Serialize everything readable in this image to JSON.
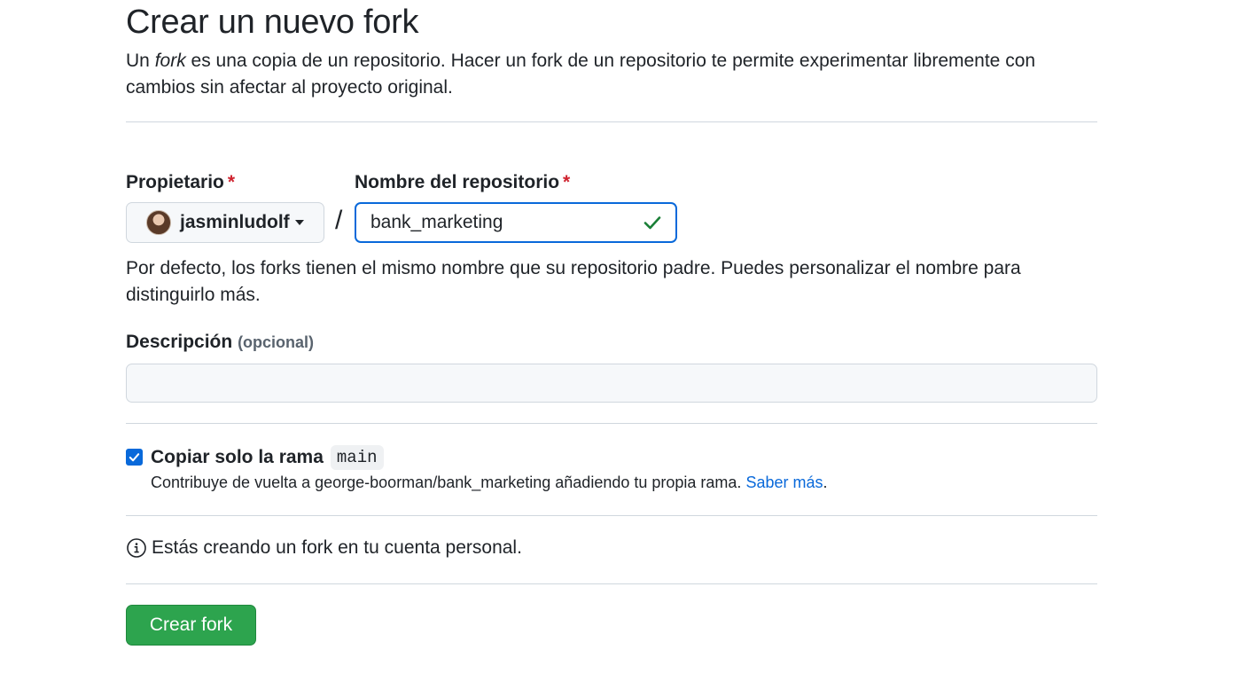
{
  "header": {
    "title": "Crear un nuevo fork",
    "subtitle_pre": "Un ",
    "subtitle_em": "fork",
    "subtitle_post": " es una copia de un repositorio. Hacer un fork de un repositorio te permite experimentar libremente con cambios sin afectar al proyecto original."
  },
  "owner": {
    "label": "Propietario",
    "required_mark": "*",
    "value": "jasminludolf"
  },
  "separator": "/",
  "repository": {
    "label": "Nombre del repositorio",
    "required_mark": "*",
    "value": "bank_marketing",
    "help": "Por defecto, los forks tienen el mismo nombre que su repositorio padre. Puedes personalizar el nombre para distinguirlo más."
  },
  "description": {
    "label": "Descripción",
    "optional": "(opcional)",
    "value": ""
  },
  "copy_branch": {
    "checked": true,
    "label": "Copiar solo la rama",
    "branch": "main",
    "help": "Contribuye de vuelta a george-boorman/bank_marketing añadiendo tu propia rama.",
    "link": "Saber más",
    "link_suffix": "."
  },
  "info": {
    "icon": "info-icon",
    "text": "Estás creando un fork en tu cuenta personal."
  },
  "actions": {
    "create_label": "Crear fork"
  },
  "colors": {
    "primary_button": "#2da44e",
    "focus_border": "#0969da",
    "required": "#cf222e",
    "link": "#0969da",
    "valid_check": "#1a7f37"
  }
}
